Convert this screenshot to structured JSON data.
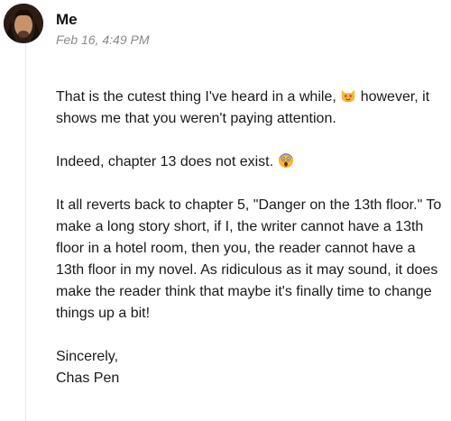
{
  "post": {
    "author": "Me",
    "timestamp": "Feb 16, 4:49 PM",
    "avatar_icon": "profile-photo-avatar"
  },
  "message": {
    "p1_text": "That is the cutest thing I've heard in a while,",
    "p1_emoji": "smiling-cat-heart-eyes-emoji",
    "p1_text2": "however, it shows me that you weren't paying attention.",
    "p2_text": "Indeed, chapter 13 does not exist.",
    "p2_emoji": "face-screaming-in-fear-emoji",
    "p3_text": "It all reverts back to chapter 5, \"Danger on the 13th floor.\" To make a long story short, if I, the writer cannot have a 13th floor in a hotel room, then you, the reader cannot have a 13th floor in my novel. As ridiculous as it may sound, it does make the reader think that maybe it's finally time to change things up a bit!",
    "signoff": "Sincerely,",
    "signature": "Chas Pen"
  },
  "colors": {
    "emoji_yellow": "#f7b731",
    "timestamp_gray": "#8a8a8a"
  }
}
